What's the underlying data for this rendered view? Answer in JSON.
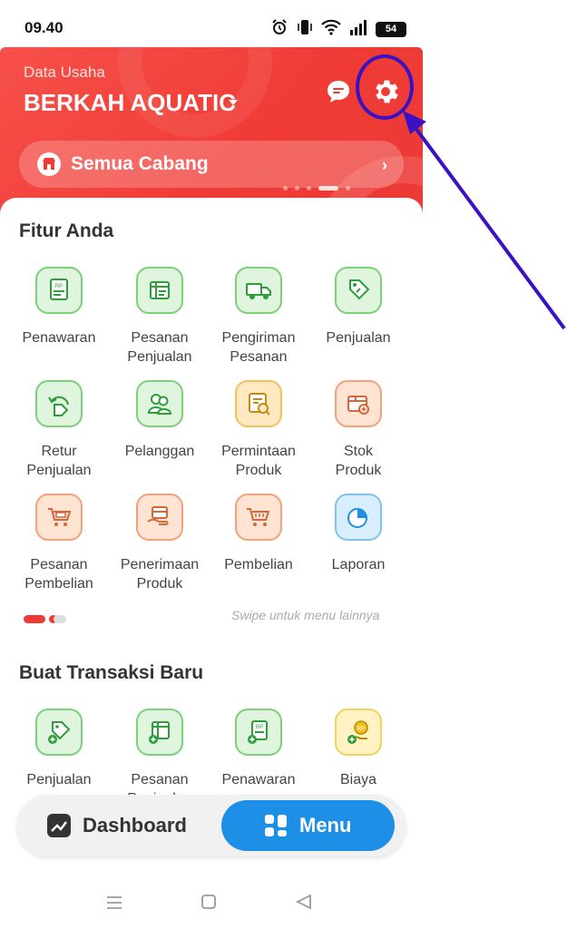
{
  "status_bar": {
    "time": "09.40",
    "battery": "54"
  },
  "header": {
    "label": "Data Usaha",
    "business_name": "BERKAH AQUATIC",
    "branch_selector": "Semua Cabang"
  },
  "features": {
    "title": "Fitur Anda",
    "items": [
      {
        "label": "Penawaran",
        "icon": "quotation-icon"
      },
      {
        "label": "Pesanan\nPenjualan",
        "icon": "sales-order-icon"
      },
      {
        "label": "Pengiriman\nPesanan",
        "icon": "delivery-truck-icon"
      },
      {
        "label": "Penjualan",
        "icon": "price-tag-icon"
      },
      {
        "label": "Retur\nPenjualan",
        "icon": "sales-return-icon"
      },
      {
        "label": "Pelanggan",
        "icon": "customers-icon"
      },
      {
        "label": "Permintaan\nProduk",
        "icon": "product-request-icon"
      },
      {
        "label": "Stok\nProduk",
        "icon": "product-stock-icon"
      },
      {
        "label": "Pesanan\nPembelian",
        "icon": "purchase-order-icon"
      },
      {
        "label": "Penerimaan\nProduk",
        "icon": "product-receipt-icon"
      },
      {
        "label": "Pembelian",
        "icon": "shopping-cart-icon"
      },
      {
        "label": "Laporan",
        "icon": "pie-chart-icon"
      }
    ],
    "swipe_hint": "Swipe untuk menu lainnya"
  },
  "new_transaction": {
    "title": "Buat Transaksi Baru",
    "items": [
      {
        "label": "Penjualan",
        "icon": "new-sale-icon"
      },
      {
        "label": "Pesanan\nPenjualan",
        "icon": "new-sales-order-icon"
      },
      {
        "label": "Penawaran",
        "icon": "new-quotation-icon"
      },
      {
        "label": "Biaya",
        "icon": "new-expense-icon"
      }
    ]
  },
  "bottom_nav": {
    "dashboard": "Dashboard",
    "menu": "Menu"
  },
  "colors": {
    "header_red": "#f03b35",
    "accent_blue": "#1e8fe6",
    "annotation_purple": "#3b11c4"
  }
}
